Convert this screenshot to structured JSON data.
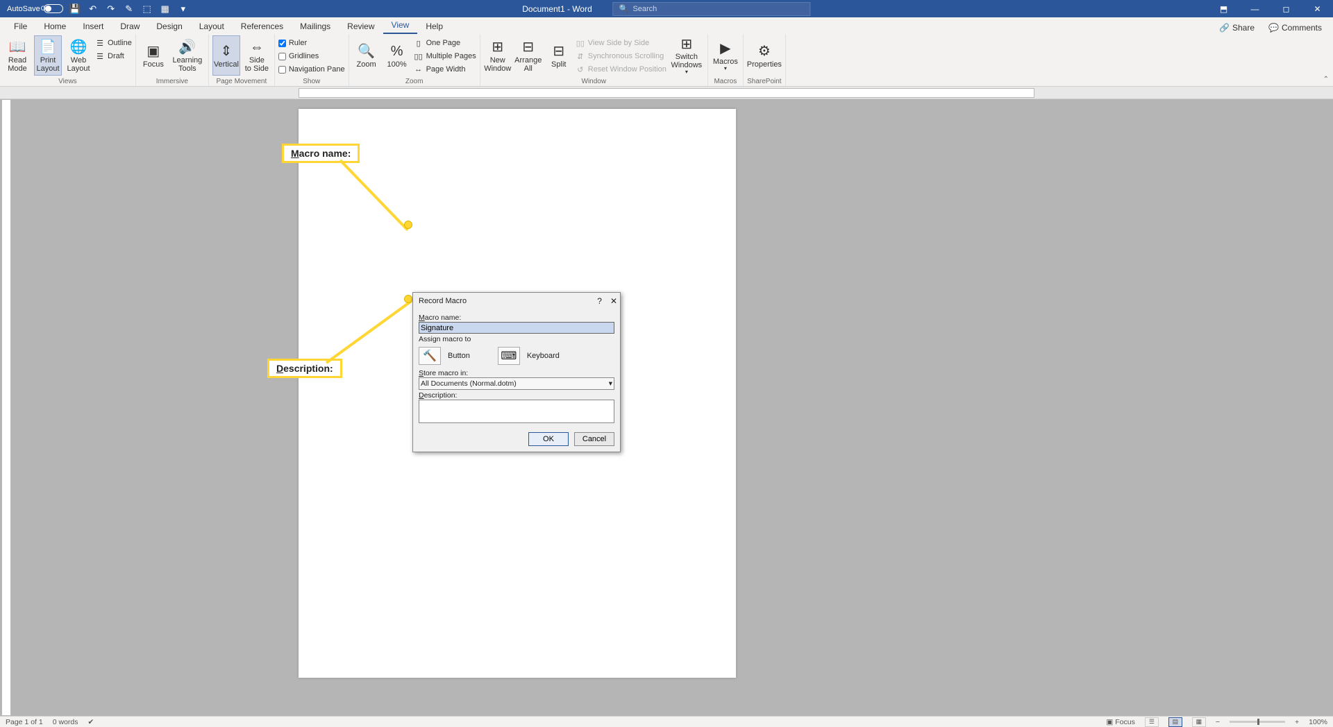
{
  "titlebar": {
    "autosave_label": "AutoSave",
    "autosave_state": "Off",
    "doc_title": "Document1 - Word",
    "search_placeholder": "Search"
  },
  "tabs": {
    "file": "File",
    "home": "Home",
    "insert": "Insert",
    "draw": "Draw",
    "design": "Design",
    "layout": "Layout",
    "references": "References",
    "mailings": "Mailings",
    "review": "Review",
    "view": "View",
    "help": "Help",
    "share": "Share",
    "comments": "Comments"
  },
  "ribbon": {
    "views": {
      "read_mode": "Read\nMode",
      "print_layout": "Print\nLayout",
      "web_layout": "Web\nLayout",
      "outline": "Outline",
      "draft": "Draft",
      "label": "Views"
    },
    "immersive": {
      "focus": "Focus",
      "learning_tools": "Learning\nTools",
      "label": "Immersive"
    },
    "page_movement": {
      "vertical": "Vertical",
      "side_to_side": "Side\nto Side",
      "label": "Page Movement"
    },
    "show": {
      "ruler": "Ruler",
      "gridlines": "Gridlines",
      "navigation_pane": "Navigation Pane",
      "label": "Show"
    },
    "zoom": {
      "zoom": "Zoom",
      "hundred": "100%",
      "one_page": "One Page",
      "multiple_pages": "Multiple Pages",
      "page_width": "Page Width",
      "label": "Zoom"
    },
    "window": {
      "new_window": "New\nWindow",
      "arrange_all": "Arrange\nAll",
      "split": "Split",
      "view_side": "View Side by Side",
      "sync_scroll": "Synchronous Scrolling",
      "reset_pos": "Reset Window Position",
      "switch_windows": "Switch\nWindows",
      "label": "Window"
    },
    "macros": {
      "macros": "Macros",
      "label": "Macros"
    },
    "sharepoint": {
      "properties": "Properties",
      "label": "SharePoint"
    }
  },
  "dialog": {
    "title": "Record Macro",
    "macro_name_label": "Macro name:",
    "macro_name_value": "Signature",
    "assign_label": "Assign macro to",
    "button_label": "Button",
    "keyboard_label": "Keyboard",
    "store_label": "Store macro in:",
    "store_value": "All Documents (Normal.dotm)",
    "description_label": "Description:",
    "ok": "OK",
    "cancel": "Cancel"
  },
  "callouts": {
    "macro_name": "Macro name:",
    "description": "Description:"
  },
  "statusbar": {
    "page": "Page 1 of 1",
    "words": "0 words",
    "focus": "Focus",
    "zoom": "100%"
  }
}
